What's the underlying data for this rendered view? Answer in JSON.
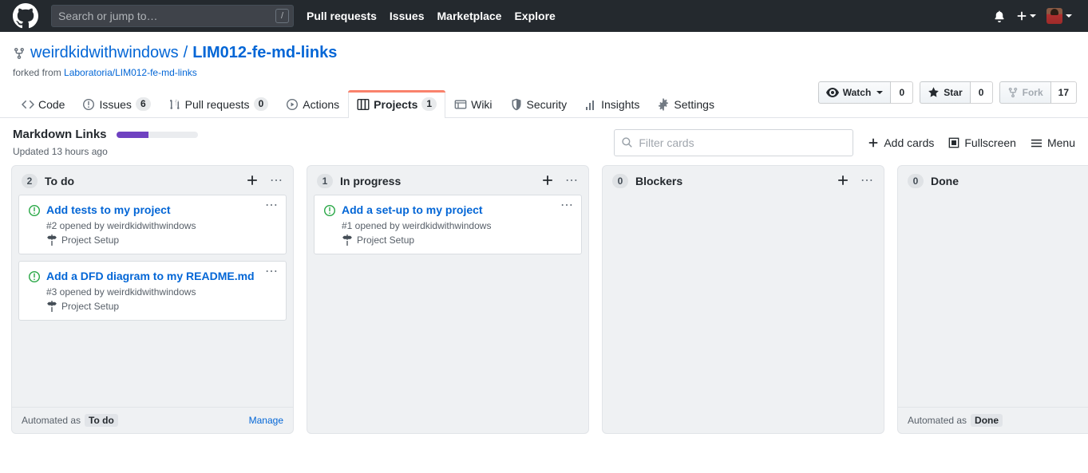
{
  "header": {
    "logo_icon": "github-mark-icon",
    "search": {
      "placeholder": "Search or jump to…",
      "value": "",
      "shortcut": "/"
    },
    "nav": [
      {
        "label": "Pull requests"
      },
      {
        "label": "Issues"
      },
      {
        "label": "Marketplace"
      },
      {
        "label": "Explore"
      }
    ],
    "notifications_icon": "bell-icon",
    "create_new_icon": "plus-icon",
    "avatar_icon": "user-avatar"
  },
  "repo": {
    "fork_icon": "repo-forked-icon",
    "owner": "weirdkidwithwindows",
    "separator": "/",
    "name": "LIM012-fe-md-links",
    "forked_from_prefix": "forked from",
    "forked_from_link": "Laboratoria/LIM012-fe-md-links",
    "actions": [
      {
        "label": "Watch",
        "count": "0",
        "icon": "eye-icon",
        "has_caret": true,
        "disabled": false
      },
      {
        "label": "Star",
        "count": "0",
        "icon": "star-icon",
        "has_caret": false,
        "disabled": false
      },
      {
        "label": "Fork",
        "count": "17",
        "icon": "repo-forked-icon",
        "has_caret": false,
        "disabled": true
      }
    ],
    "tabs": [
      {
        "label": "Code",
        "icon": "code-icon",
        "count": null,
        "active": false
      },
      {
        "label": "Issues",
        "icon": "issue-opened-icon",
        "count": "6",
        "active": false
      },
      {
        "label": "Pull requests",
        "icon": "git-pull-request-icon",
        "count": "0",
        "active": false
      },
      {
        "label": "Actions",
        "icon": "play-icon",
        "count": null,
        "active": false
      },
      {
        "label": "Projects",
        "icon": "project-icon",
        "count": "1",
        "active": true
      },
      {
        "label": "Wiki",
        "icon": "book-icon",
        "count": null,
        "active": false
      },
      {
        "label": "Security",
        "icon": "shield-icon",
        "count": null,
        "active": false
      },
      {
        "label": "Insights",
        "icon": "graph-icon",
        "count": null,
        "active": false
      },
      {
        "label": "Settings",
        "icon": "gear-icon",
        "count": null,
        "active": false
      }
    ]
  },
  "project": {
    "name": "Markdown Links",
    "progress_percent": 40,
    "progress_color": "#6f42c1",
    "updated": "Updated 13 hours ago",
    "filter": {
      "placeholder": "Filter cards",
      "value": "",
      "icon": "search-icon"
    },
    "actions": [
      {
        "label": "Add cards",
        "icon": "plus-icon"
      },
      {
        "label": "Fullscreen",
        "icon": "screen-full-icon"
      },
      {
        "label": "Menu",
        "icon": "three-bars-icon"
      }
    ]
  },
  "board": {
    "columns": [
      {
        "title": "To do",
        "count": "2",
        "add_icon": "plus-icon",
        "menu_icon": "kebab-horizontal-icon",
        "cards": [
          {
            "icon": "issue-opened-icon",
            "title": "Add tests to my project",
            "meta": "#2 opened by weirdkidwithwindows",
            "milestone": "Project Setup",
            "milestone_icon": "milestone-icon"
          },
          {
            "icon": "issue-opened-icon",
            "title": "Add a DFD diagram to my README.md",
            "meta": "#3 opened by weirdkidwithwindows",
            "milestone": "Project Setup",
            "milestone_icon": "milestone-icon"
          }
        ],
        "footer": {
          "prefix": "Automated as",
          "chip": "To do",
          "manage": "Manage"
        }
      },
      {
        "title": "In progress",
        "count": "1",
        "add_icon": "plus-icon",
        "menu_icon": "kebab-horizontal-icon",
        "cards": [
          {
            "icon": "issue-opened-icon",
            "title": "Add a set-up to my project",
            "meta": "#1 opened by weirdkidwithwindows",
            "milestone": "Project Setup",
            "milestone_icon": "milestone-icon"
          }
        ],
        "footer": null
      },
      {
        "title": "Blockers",
        "count": "0",
        "add_icon": "plus-icon",
        "menu_icon": "kebab-horizontal-icon",
        "cards": [],
        "footer": null
      },
      {
        "title": "Done",
        "count": "0",
        "add_icon": null,
        "menu_icon": null,
        "cards": [],
        "footer": {
          "prefix": "Automated as",
          "chip": "Done",
          "manage": null
        }
      }
    ]
  }
}
